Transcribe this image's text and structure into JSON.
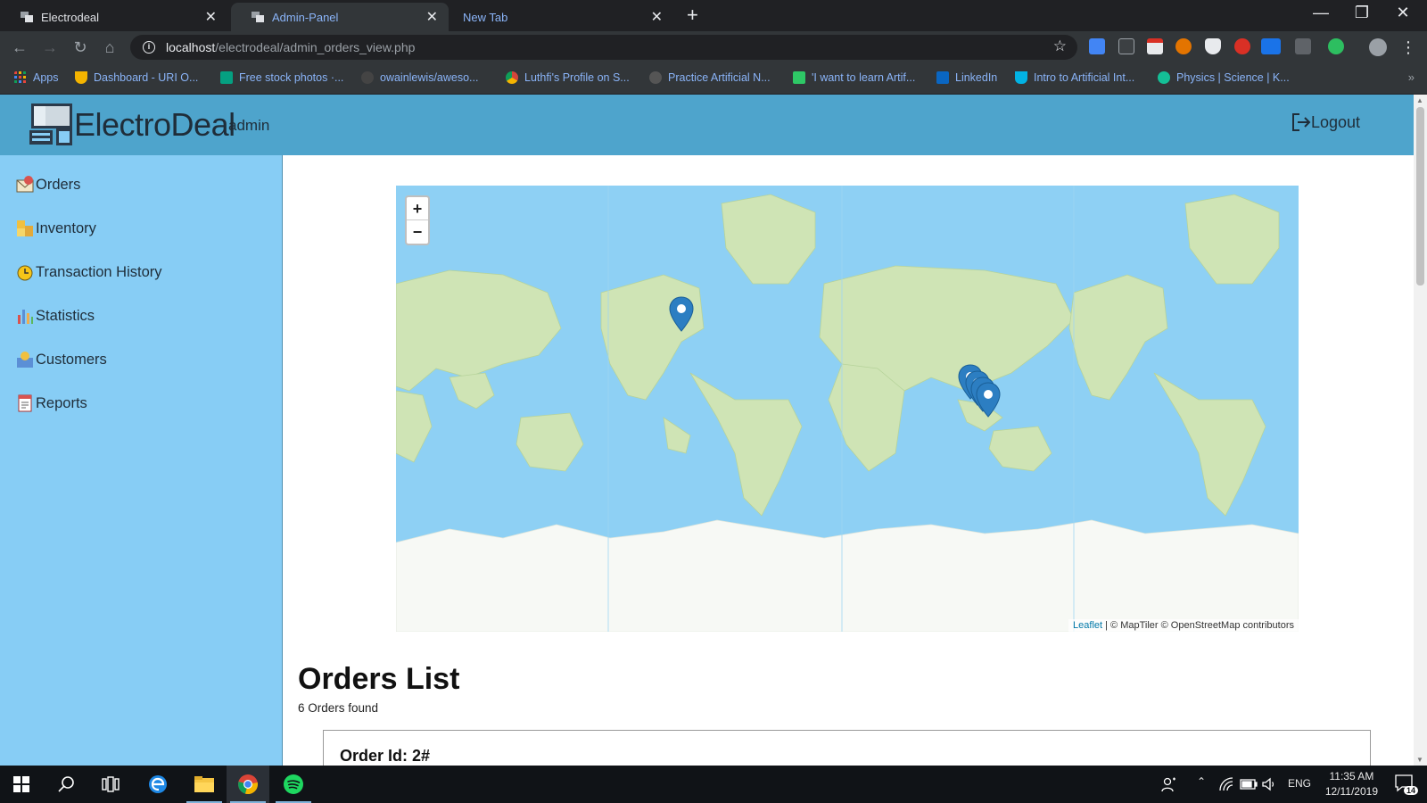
{
  "browser": {
    "tabs": [
      {
        "label": "Electrodeal",
        "state": "inactive"
      },
      {
        "label": "Admin-Panel",
        "state": "active"
      },
      {
        "label": "New Tab",
        "state": "inactive"
      }
    ],
    "new_tab_symbol": "+",
    "url_host": "localhost",
    "url_path": "/electrodeal/admin_orders_view.php",
    "bookmarks": [
      {
        "label": "Apps",
        "icon": "apps-grid-icon",
        "color": "#e8453c"
      },
      {
        "label": "Dashboard - URI O...",
        "icon": "trophy-icon",
        "color": "#f4b400"
      },
      {
        "label": "Free stock photos ·...",
        "icon": "pexels-icon",
        "color": "#05a081"
      },
      {
        "label": "owainlewis/aweso...",
        "icon": "github-icon",
        "color": "#444444"
      },
      {
        "label": "Luthfi's Profile on S...",
        "icon": "chrome-like-icon",
        "color": "#d4463a"
      },
      {
        "label": "Practice Artificial N...",
        "icon": "hackerrank-icon",
        "color": "#555555"
      },
      {
        "label": "'I want to learn Artif...",
        "icon": "quora-icon",
        "color": "#2ec866"
      },
      {
        "label": "LinkedIn",
        "icon": "linkedin-icon",
        "color": "#0a66c2"
      },
      {
        "label": "Intro to Artificial Int...",
        "icon": "udacity-icon",
        "color": "#02b3e4"
      },
      {
        "label": "Physics | Science | K...",
        "icon": "khan-academy-icon",
        "color": "#14bf96"
      }
    ],
    "more_symbol": "»"
  },
  "header": {
    "brand": "ElectroDeal",
    "brand_sub": "admin",
    "logout_label": "Logout"
  },
  "sidebar": {
    "items": [
      {
        "label": "Orders",
        "icon": "orders-envelope-icon"
      },
      {
        "label": "Inventory",
        "icon": "inventory-boxes-icon"
      },
      {
        "label": "Transaction History",
        "icon": "clock-icon"
      },
      {
        "label": "Statistics",
        "icon": "bar-chart-icon"
      },
      {
        "label": "Customers",
        "icon": "customers-icon"
      },
      {
        "label": "Reports",
        "icon": "report-document-icon"
      }
    ]
  },
  "map": {
    "zoom_in": "+",
    "zoom_out": "−",
    "attribution_leaflet": "Leaflet",
    "attribution_rest": " | © MapTiler © OpenStreetMap contributors",
    "marker_color": "#2c7ec2",
    "water_color": "#8ed0f4",
    "land_color": "#cfe4b5"
  },
  "main": {
    "title": "Orders List",
    "count_text": "6 Orders found",
    "first_order_label": "Order Id: 2#"
  },
  "taskbar": {
    "language": "ENG",
    "time": "11:35 AM",
    "date": "12/11/2019",
    "notifications": "14"
  },
  "colors": {
    "header": "#4ea4cc",
    "sidebar": "#87cdf5",
    "chrome_dark": "#202124"
  }
}
